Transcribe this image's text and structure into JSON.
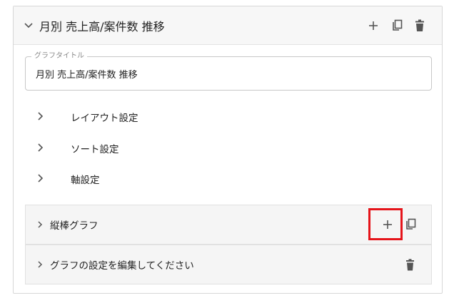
{
  "header": {
    "title": "月別 売上高/案件数 推移",
    "icons": [
      "chevron-down-icon",
      "plus-icon",
      "copy-icon",
      "trash-icon"
    ]
  },
  "title_field": {
    "legend": "グラフタイトル",
    "value": "月別 売上高/案件数 推移"
  },
  "sections": [
    {
      "label": "レイアウト設定",
      "icon": "chevron-right-icon"
    },
    {
      "label": "ソート設定",
      "icon": "chevron-right-icon"
    },
    {
      "label": "軸設定",
      "icon": "chevron-right-icon"
    }
  ],
  "series_panels": [
    {
      "label": "縦棒グラフ",
      "icons": [
        "chevron-right-icon",
        "plus-icon",
        "copy-icon"
      ],
      "highlighted_action": "plus-icon"
    },
    {
      "label": "グラフの設定を編集してください",
      "icons": [
        "chevron-right-icon",
        "trash-icon"
      ]
    }
  ],
  "colors": {
    "highlight": "#e5141a",
    "header_bg": "#f7f7f7",
    "panel_bg": "#f5f5f5",
    "icon": "#555555"
  }
}
